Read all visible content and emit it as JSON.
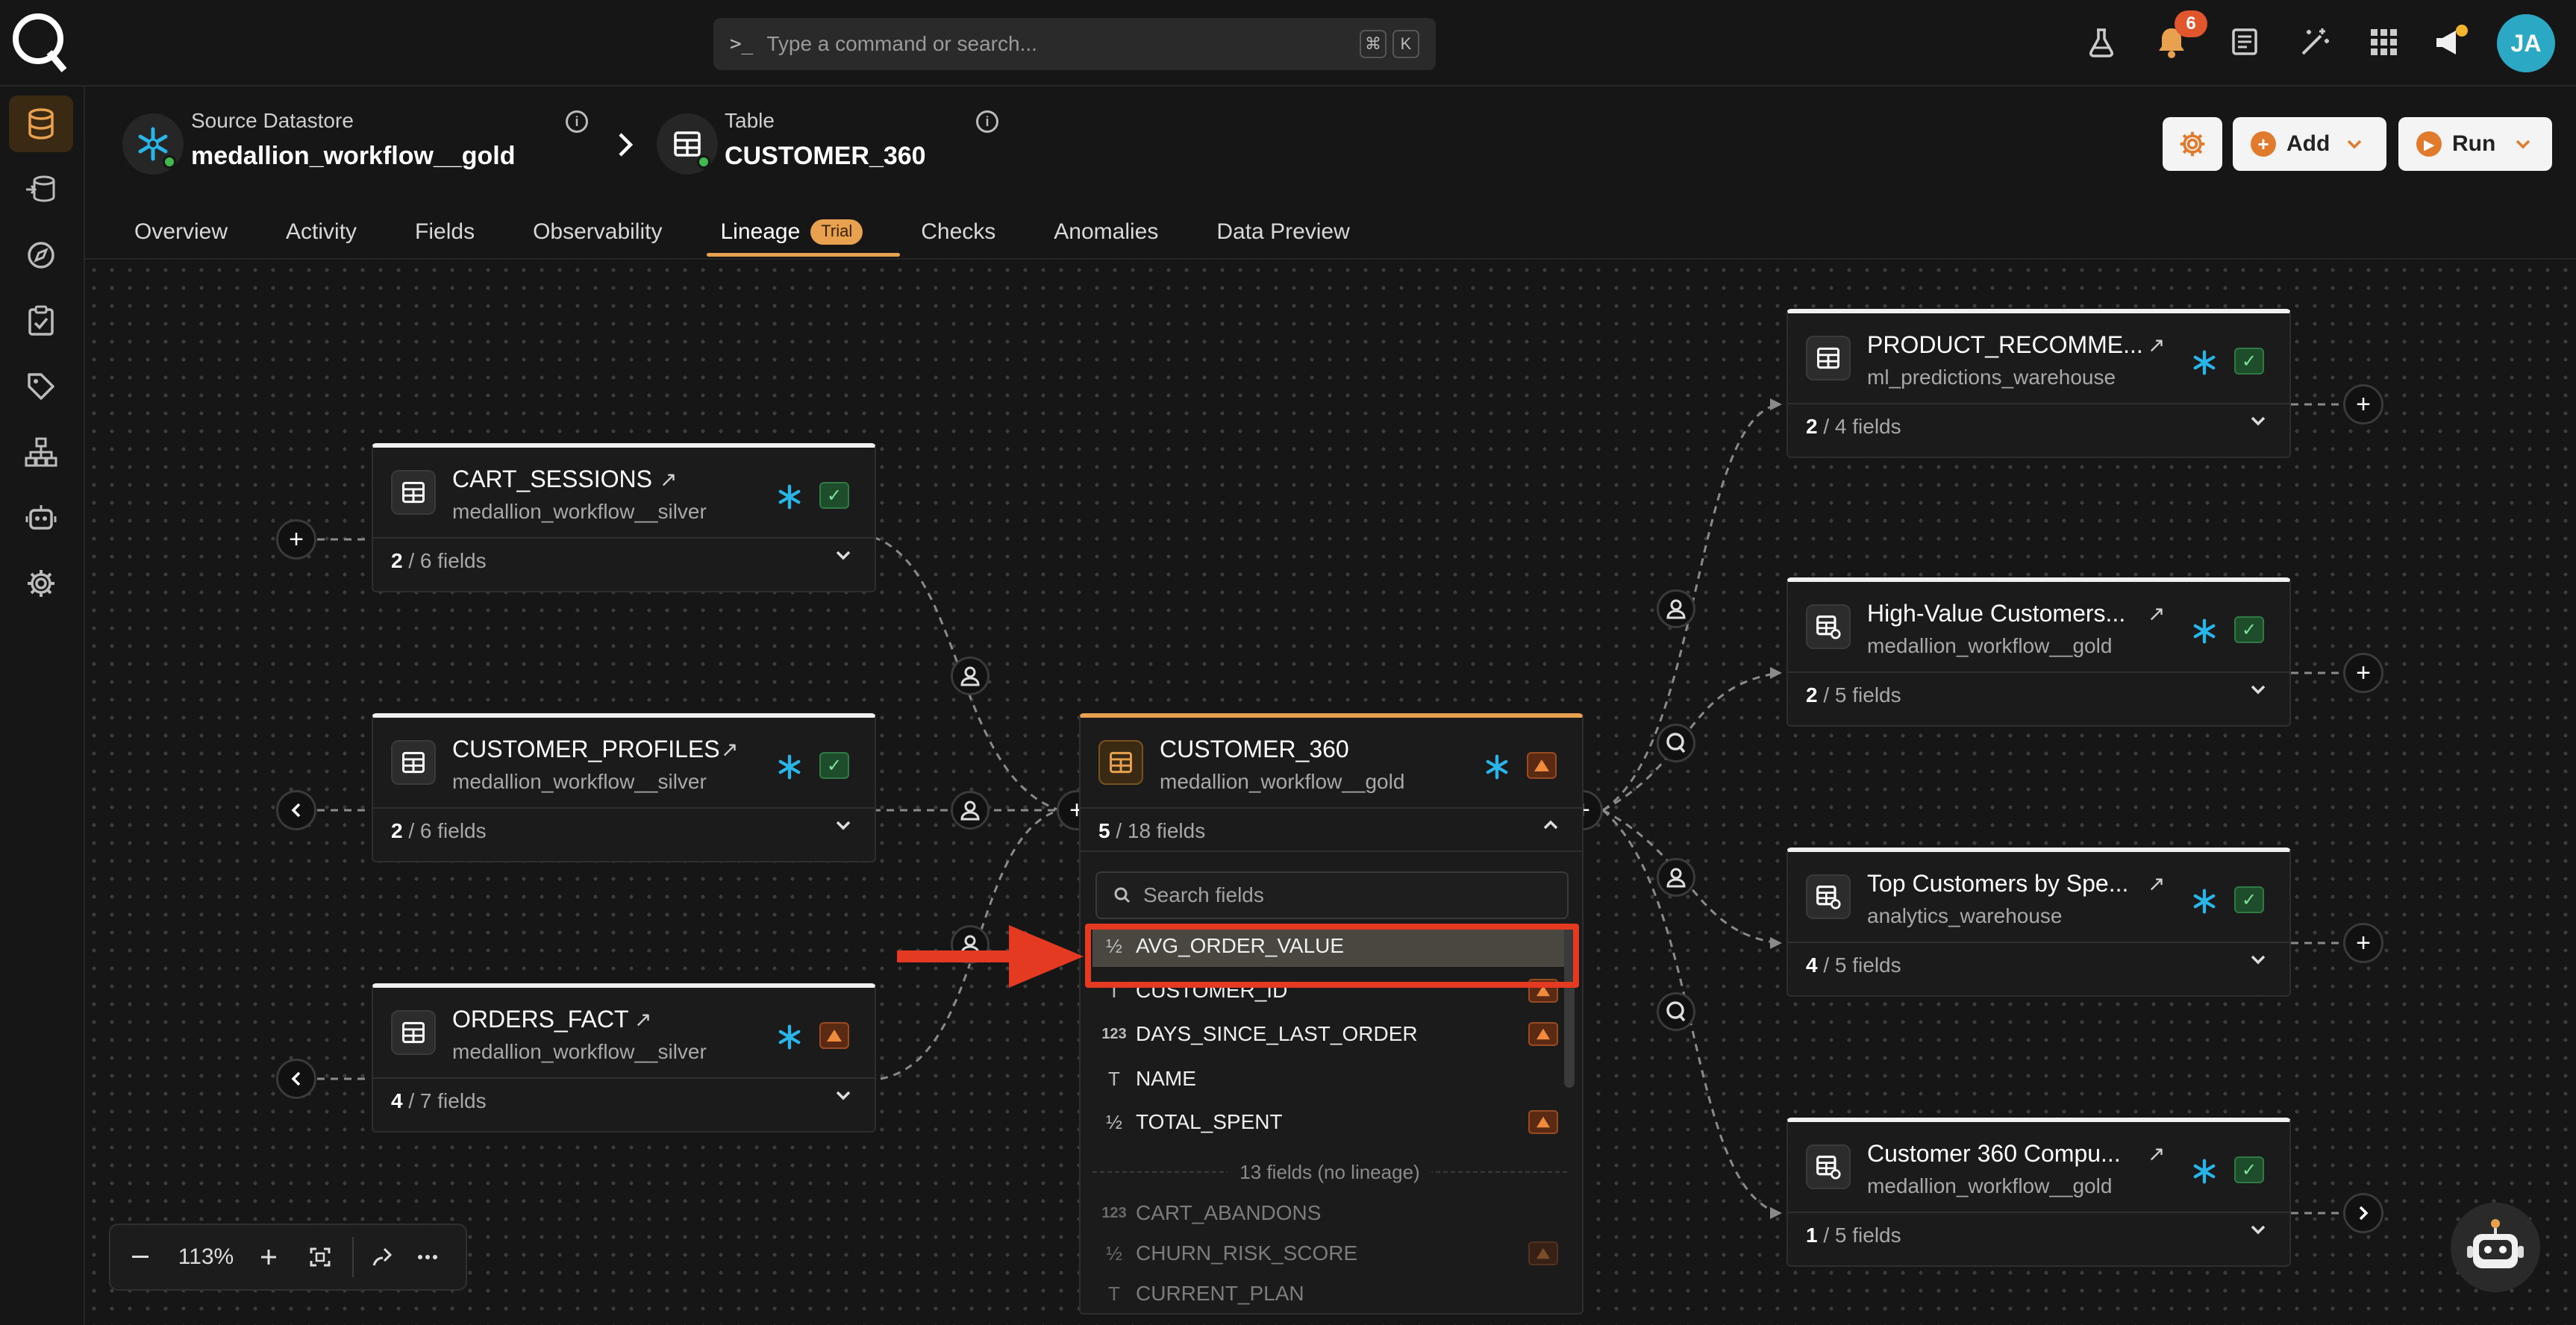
{
  "topbar": {
    "search_placeholder": "Type a command or search...",
    "shortcut_keys": [
      "⌘",
      "K"
    ],
    "notification_count": "6",
    "avatar_initials": "JA"
  },
  "header": {
    "source_label": "Source Datastore",
    "source_value": "medallion_workflow__gold",
    "table_label": "Table",
    "table_value": "CUSTOMER_360",
    "add_label": "Add",
    "run_label": "Run"
  },
  "tabs": [
    {
      "label": "Overview"
    },
    {
      "label": "Activity"
    },
    {
      "label": "Fields"
    },
    {
      "label": "Observability"
    },
    {
      "label": "Lineage",
      "badge": "Trial",
      "active": true
    },
    {
      "label": "Checks"
    },
    {
      "label": "Anomalies"
    },
    {
      "label": "Data Preview"
    }
  ],
  "nodes": {
    "cart_sessions": {
      "name": "CART_SESSIONS",
      "source": "medallion_workflow__silver",
      "selected": "2",
      "fields": " / 6 fields",
      "status": "ok"
    },
    "customer_profiles": {
      "name": "CUSTOMER_PROFILES",
      "source": "medallion_workflow__silver",
      "selected": "2",
      "fields": " / 6 fields",
      "status": "ok"
    },
    "orders_fact": {
      "name": "ORDERS_FACT",
      "source": "medallion_workflow__silver",
      "selected": "4",
      "fields": " / 7 fields",
      "status": "warning"
    },
    "customer_360": {
      "name": "CUSTOMER_360",
      "source": "medallion_workflow__gold",
      "selected": "5",
      "fields": " / 18 fields",
      "status": "warning"
    },
    "product_recomme": {
      "name": "PRODUCT_RECOMME...",
      "source": "ml_predictions_warehouse",
      "selected": "2",
      "fields": " / 4 fields",
      "status": "ok"
    },
    "high_value": {
      "name": "High-Value Customers...",
      "source": "medallion_workflow__gold",
      "selected": "2",
      "fields": " / 5 fields",
      "status": "ok"
    },
    "top_customers": {
      "name": "Top Customers by Spe...",
      "source": "analytics_warehouse",
      "selected": "4",
      "fields": " / 5 fields",
      "status": "ok"
    },
    "customer_360_compu": {
      "name": "Customer 360 Compu...",
      "source": "medallion_workflow__gold",
      "selected": "1",
      "fields": " / 5 fields",
      "status": "ok"
    }
  },
  "field_list": {
    "search_placeholder": "Search fields",
    "lineage_fields": [
      {
        "type": "½",
        "name": "AVG_ORDER_VALUE",
        "warning": false,
        "highlighted": true
      },
      {
        "type": "T",
        "name": "CUSTOMER_ID",
        "warning": true
      },
      {
        "type": "123",
        "name": "DAYS_SINCE_LAST_ORDER",
        "warning": true
      },
      {
        "type": "T",
        "name": "NAME",
        "warning": false
      },
      {
        "type": "½",
        "name": "TOTAL_SPENT",
        "warning": true
      }
    ],
    "no_lineage_label": "13 fields (no lineage)",
    "other_fields": [
      {
        "type": "123",
        "name": "CART_ABANDONS",
        "warning": false
      },
      {
        "type": "½",
        "name": "CHURN_RISK_SCORE",
        "warning": true
      },
      {
        "type": "T",
        "name": "CURRENT_PLAN",
        "warning": false
      }
    ]
  },
  "zoom": {
    "level": "113%"
  },
  "colors": {
    "accent": "#e8a14e",
    "highlight": "#e53a22",
    "ok": "#3fb950",
    "warning": "#e0682e",
    "snowflake": "#29b5e8"
  }
}
